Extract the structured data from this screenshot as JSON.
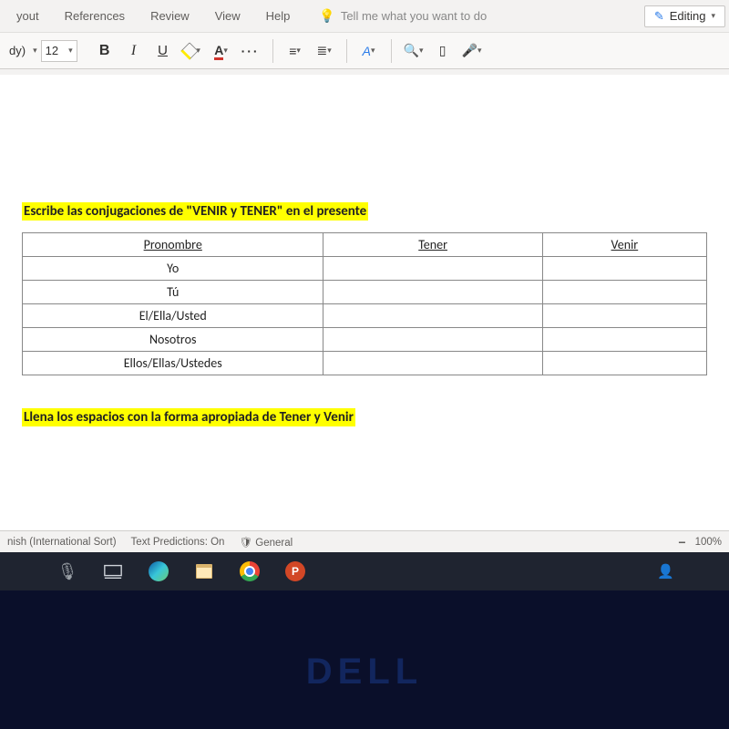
{
  "ribbon": {
    "tabs": [
      "yout",
      "References",
      "Review",
      "View",
      "Help"
    ],
    "tellme": "Tell me what you want to do",
    "editing": "Editing"
  },
  "toolbar": {
    "font_style_label": "dy)",
    "font_size": "12",
    "bold": "B",
    "italic": "I",
    "underline": "U",
    "font_a": "A",
    "more": "···"
  },
  "document": {
    "heading1": "Escribe las conjugaciones de \"VENIR y TENER\" en el presente",
    "table": {
      "headers": [
        "Pronombre",
        "Tener",
        "Venir"
      ],
      "rows": [
        [
          "Yo",
          "",
          ""
        ],
        [
          "Tú",
          "",
          ""
        ],
        [
          "El/Ella/Usted",
          "",
          ""
        ],
        [
          "Nosotros",
          "",
          ""
        ],
        [
          "Ellos/Ellas/Ustedes",
          "",
          ""
        ]
      ]
    },
    "heading2": "Llena los espacios con la forma apropiada de Tener y Venir"
  },
  "statusbar": {
    "lang": "nish (International Sort)",
    "predictions": "Text Predictions: On",
    "sensitivity": "General",
    "zoom": "100%"
  },
  "taskbar": {
    "ppt": "P"
  },
  "brand": "DELL"
}
